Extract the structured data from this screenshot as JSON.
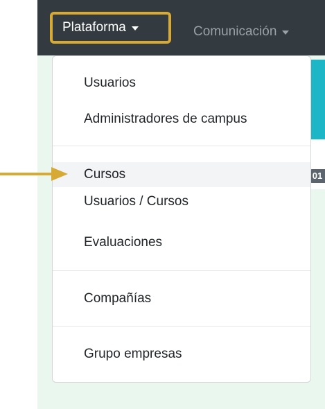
{
  "navbar": {
    "items": [
      {
        "label": "Plataforma",
        "highlighted": true
      },
      {
        "label": "Comunicación",
        "highlighted": false
      }
    ],
    "background": "#333a40",
    "highlight_color": "#d6aa34"
  },
  "dropdown": {
    "groups": [
      {
        "items": [
          {
            "label": "Usuarios"
          },
          {
            "label": "Administradores de campus"
          }
        ]
      },
      {
        "items": [
          {
            "label": "Cursos",
            "active": true
          },
          {
            "label": "Usuarios / Cursos"
          },
          {
            "label": "Evaluaciones"
          }
        ]
      },
      {
        "items": [
          {
            "label": "Compañías"
          }
        ]
      },
      {
        "items": [
          {
            "label": "Grupo empresas"
          }
        ]
      }
    ]
  },
  "background_page": {
    "badge_text": "01",
    "band_color": "#1cb6c7",
    "content_bg_color": "#eaf7ef"
  },
  "annotation": {
    "arrow_color": "#d6aa34",
    "points_to": "Cursos"
  }
}
